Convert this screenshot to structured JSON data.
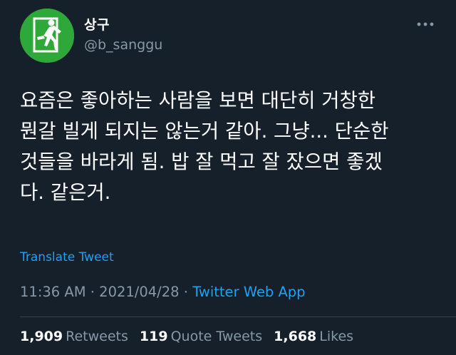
{
  "user": {
    "display_name": "상구",
    "handle": "@b_sanggu",
    "avatar_icon": "running-man-exit-sign-icon",
    "avatar_color": "#2fa83a"
  },
  "more_icon": "more-horizontal-icon",
  "tweet": {
    "lines": [
      "요즘은 좋아하는 사람을 보면 대단히 거창한",
      "뭔갈 빌게 되지는 않는거 같아. 그냥... 단순한",
      "것들을 바라게 됨. 밥 잘 먹고 잘 잤으면 좋겠",
      "다. 같은거."
    ],
    "translate_label": "Translate Tweet"
  },
  "meta": {
    "time": "11:36 AM",
    "separator": " · ",
    "date": "2021/04/28",
    "source": "Twitter Web App"
  },
  "stats": {
    "retweets_count": "1,909",
    "retweets_label": "Retweets",
    "quotes_count": "119",
    "quotes_label": "Quote Tweets",
    "likes_count": "1,668",
    "likes_label": "Likes"
  },
  "colors": {
    "background": "#15202b",
    "accent": "#1da1f2",
    "secondary_text": "#8899a6",
    "divider": "#38444d"
  }
}
